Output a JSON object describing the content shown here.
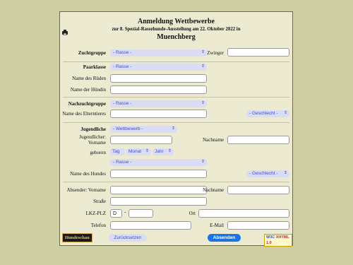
{
  "header": {
    "title": "Anmeldung Wettbewerbe",
    "subtitle": "zur 8. Spezial-Rassehunde-Ausstellung am 22. Oktober 2022 in",
    "city": "Muenchberg"
  },
  "zuchtgruppe": {
    "label": "Zuchtgruppe",
    "rasse_select": "- Rasse -",
    "zwinger_label": "Zwinger",
    "zwinger_value": ""
  },
  "paarklasse": {
    "label": "Paarklasse",
    "rasse_select": "- Rasse -",
    "ruede_label": "Name des Rüden",
    "ruede_value": "",
    "huendin_label": "Name der Hündin",
    "huendin_value": ""
  },
  "nachzuchtgruppe": {
    "label": "Nachzuchtgruppe",
    "rasse_select": "- Rasse -",
    "elterntier_label": "Name des Elterntieres",
    "elterntier_value": "",
    "geschlecht_select": "- Geschlecht -"
  },
  "jugendliche": {
    "label": "Jugendliche",
    "wettbewerb_select": "- Wettbewerb -",
    "vorname_label_1": "Jugendlicher:",
    "vorname_label_2": "Vorname",
    "vorname_value": "",
    "nachname_label": "Nachname",
    "nachname_value": "",
    "geboren_label": "geboren",
    "tag_select": "Tag",
    "monat_select": "Monat",
    "jahr_select": "Jahr",
    "rasse_select": "- Rasse -",
    "hund_label": "Name des Hundes",
    "hund_value": "",
    "geschlecht_select": "- Geschlecht -"
  },
  "absender": {
    "vorname_label": "Absender: Vorname",
    "vorname_value": "",
    "nachname_label": "Nachname",
    "nachname_value": "",
    "strasse_label": "Straße",
    "strasse_value": "",
    "plz_label": "LKZ-PLZ",
    "lkz_value": "D",
    "plz_sep": "-",
    "plz_value": "",
    "ort_label": "Ort",
    "ort_value": "",
    "telefon_label": "Telefon",
    "telefon_value": "",
    "email_label": "E-Mail",
    "email_value": ""
  },
  "footer": {
    "logo": "Hundeschau",
    "reset_label": "Zurücksetzen",
    "submit_label": "Absenden",
    "badge_w3": "W3C",
    "badge_text": "XHTML 1.0"
  },
  "colors": {
    "page_bg": "#cdcfa2",
    "panel_bg": "#ecebd2",
    "accent": "#1c73e8",
    "select_bg": "#d9dcf3"
  },
  "icons": {
    "print": "printer-icon",
    "chevron": "chevron-updown-icon"
  }
}
